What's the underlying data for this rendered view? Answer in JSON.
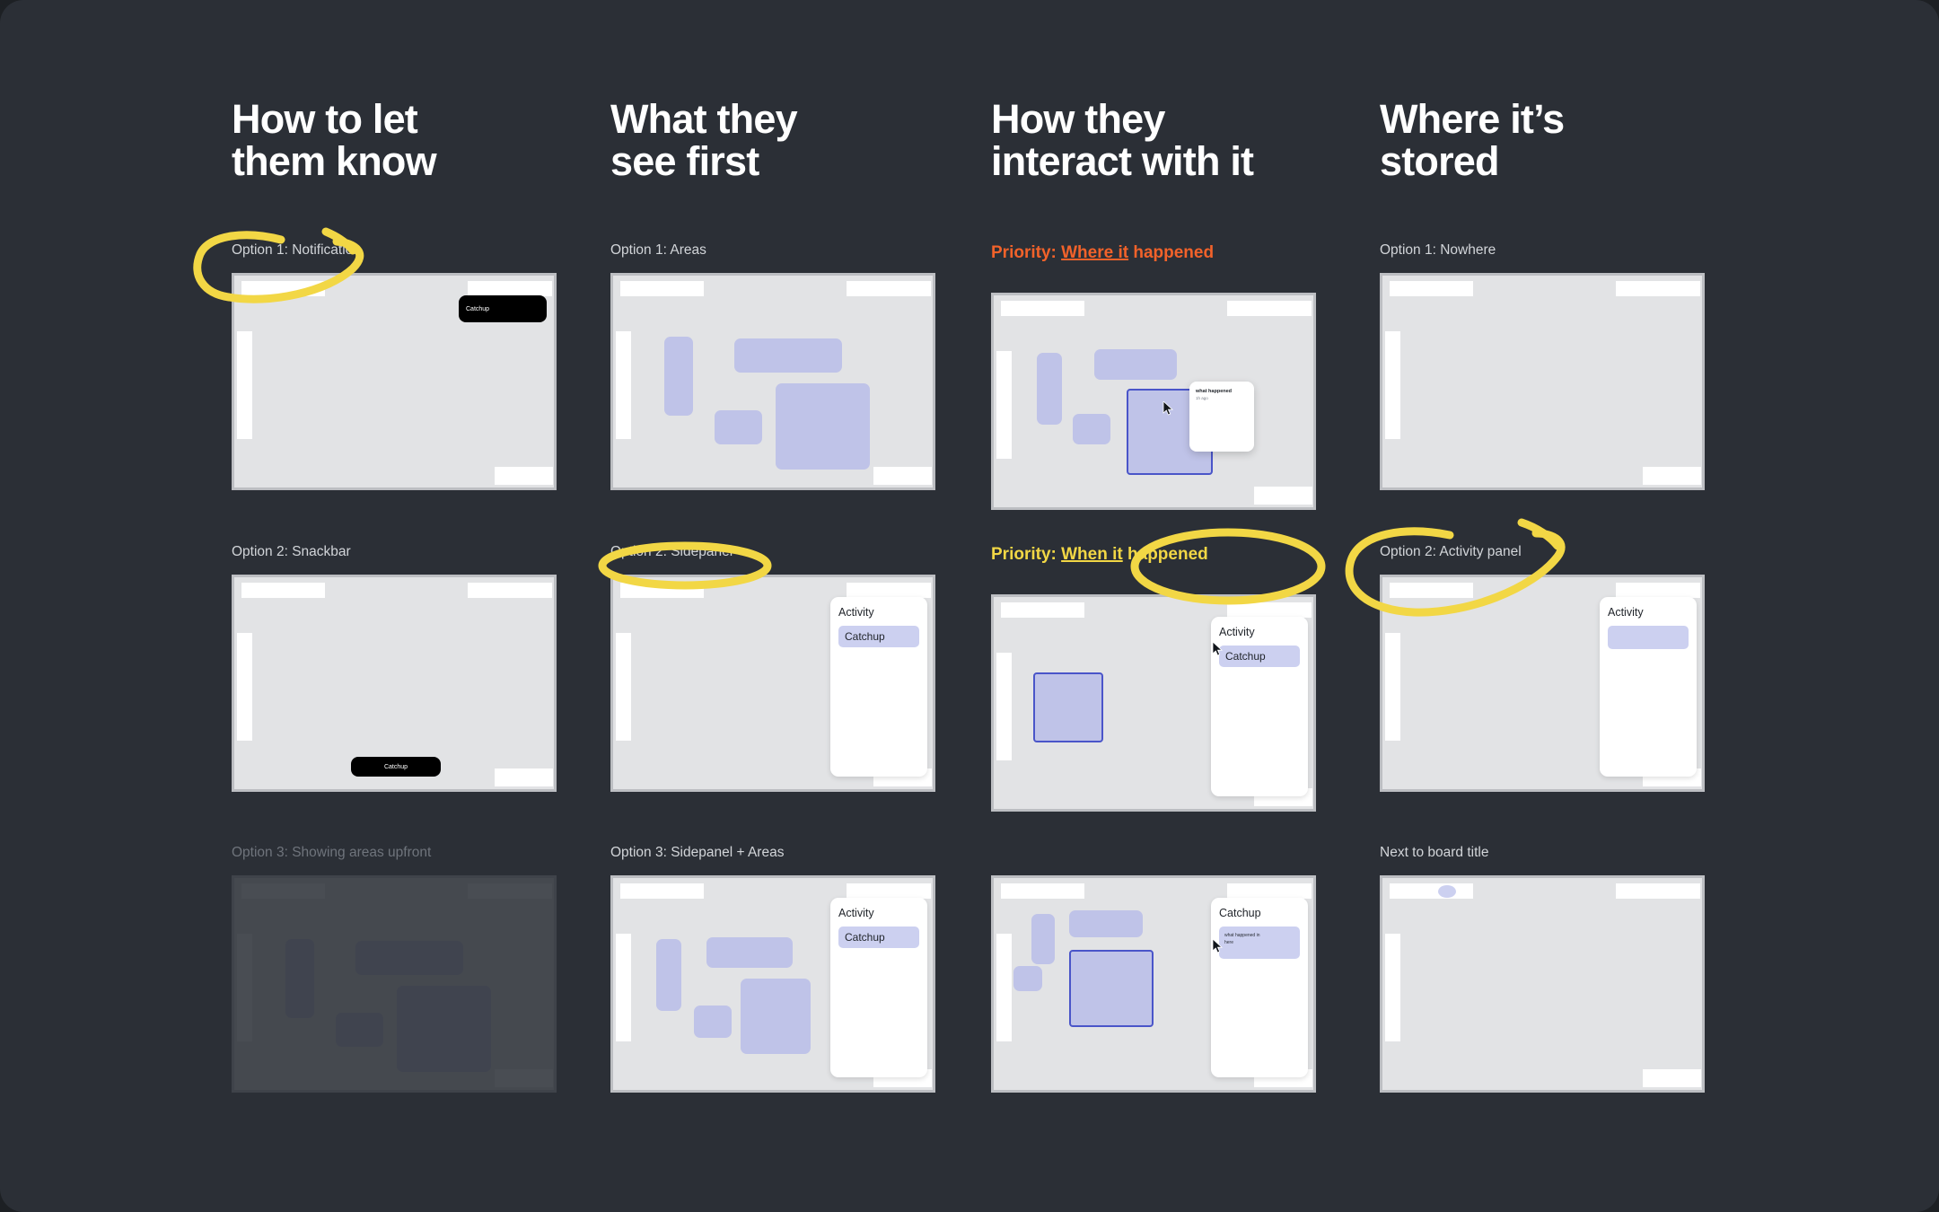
{
  "theme": {
    "background": "#2b2f36",
    "page": "#1d2024",
    "surface": "#e2e3e5",
    "surface_border": "#bcbec2",
    "block": "#bfc3e8",
    "block_selected_border": "#4a55c9",
    "panel": "#ffffff",
    "toast": "#000000",
    "title": "#ffffff",
    "caption": "#d2d5d9",
    "caption_dim": "#6f747c",
    "annotation_yellow": "#f2d745",
    "priority_orange": "#f2622a",
    "priority_yellow": "#f2d745"
  },
  "columns": [
    {
      "title": "How to let\nthem know",
      "rows": [
        {
          "caption": "Option 1: Notification",
          "caption_style": "normal",
          "annotated": true,
          "annotation": "circle-around-caption",
          "wireframe": "notification",
          "toast_label": "Catchup"
        },
        {
          "caption": "Option 2: Snackbar",
          "caption_style": "normal",
          "annotated": false,
          "wireframe": "snackbar",
          "toast_label": "Catchup"
        },
        {
          "caption": "Option 3: Showing areas upfront",
          "caption_style": "dim",
          "annotated": false,
          "wireframe": "areas-faded"
        }
      ]
    },
    {
      "title": "What they\nsee first",
      "rows": [
        {
          "caption": "Option 1: Areas",
          "caption_style": "normal",
          "annotated": false,
          "wireframe": "areas"
        },
        {
          "caption": "Option 2: Sidepanel",
          "caption_style": "normal",
          "annotated": true,
          "annotation": "ellipse-around-caption",
          "wireframe": "sidepanel",
          "panel_title": "Activity",
          "panel_item": "Catchup"
        },
        {
          "caption": "Option 3: Sidepanel + Areas",
          "caption_style": "normal",
          "annotated": false,
          "wireframe": "sidepanel-areas",
          "panel_title": "Activity",
          "panel_item": "Catchup"
        }
      ]
    },
    {
      "title": "How they\ninteract with it",
      "rows": [
        {
          "caption": "Priority: Where it happened",
          "caption_underlined": "Where it",
          "caption_prefix": "Priority: ",
          "caption_suffix": "happened",
          "caption_style": "priority-orange",
          "annotated": false,
          "wireframe": "areas-popover",
          "popover_title": "what happened",
          "popover_subtitle": "1h ago"
        },
        {
          "caption": "Priority: When it happened",
          "caption_underlined": "When it",
          "caption_prefix": "Priority: ",
          "caption_suffix": "happened",
          "caption_style": "priority-yellow",
          "annotated": true,
          "annotation": "circle-around-priority",
          "wireframe": "sidepanel-selected",
          "panel_title": "Activity",
          "panel_item": "Catchup"
        },
        {
          "caption": "",
          "caption_style": "spacer",
          "annotated": false,
          "wireframe": "catchup-panel",
          "panel_title": "Catchup",
          "panel_item": "what happened in\nhere"
        }
      ]
    },
    {
      "title": "Where it’s\nstored",
      "rows": [
        {
          "caption": "Option 1: Nowhere",
          "caption_style": "normal",
          "annotated": false,
          "wireframe": "empty"
        },
        {
          "caption": "Option 2: Activity panel",
          "caption_style": "normal",
          "annotated": true,
          "annotation": "circle-around-caption",
          "wireframe": "activity-panel",
          "panel_title": "Activity",
          "panel_item": ""
        },
        {
          "caption": "Next to board title",
          "caption_style": "normal",
          "annotated": false,
          "wireframe": "board-title-dot"
        }
      ]
    }
  ]
}
